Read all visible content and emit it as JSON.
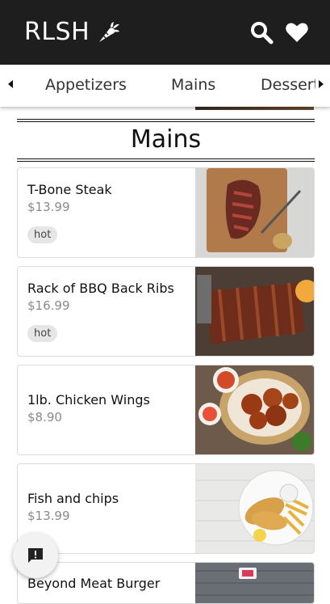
{
  "header": {
    "brand": "RLSH",
    "brand_icon": "carrot-icon",
    "search_icon": "search-icon",
    "favorites_icon": "heart-icon"
  },
  "tabs": [
    "Appetizers",
    "Mains",
    "Desserts"
  ],
  "section": {
    "title": "Mains"
  },
  "items": [
    {
      "name": "T-Bone Steak",
      "price": "$13.99",
      "tag": "hot"
    },
    {
      "name": "Rack of BBQ Back Ribs",
      "price": "$16.99",
      "tag": "hot"
    },
    {
      "name": "1lb. Chicken Wings",
      "price": "$8.90"
    },
    {
      "name": "Fish and chips",
      "price": "$13.99"
    },
    {
      "name": "Beyond Meat Burger"
    }
  ],
  "fab": {
    "icon": "feedback-icon"
  },
  "colors": {
    "topbar": "#1e1e1e",
    "tag_bg": "#e6e6e6",
    "price": "#8a8a8a"
  }
}
